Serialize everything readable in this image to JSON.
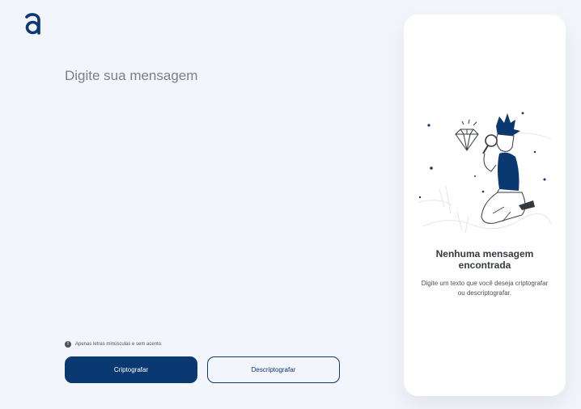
{
  "logo": {
    "icon": "alura-a-logo-icon",
    "color": "#0a3871"
  },
  "editor": {
    "placeholder": "Digite sua mensagem",
    "value": ""
  },
  "hint": {
    "icon": "info-icon",
    "text": "Apenas letras minúsculas e sem acento."
  },
  "buttons": {
    "encrypt_label": "Criptografar",
    "decrypt_label": "Descriptografar"
  },
  "output": {
    "illustration": "person-with-magnifying-glass-illustration",
    "title_line1": "Nenhuma mensagem",
    "title_line2": "encontrada",
    "description": "Digite um texto que você deseja criptografar ou descriptografar."
  },
  "colors": {
    "background": "#f3f5fc",
    "primary": "#0a3871",
    "panel": "#ffffff"
  }
}
